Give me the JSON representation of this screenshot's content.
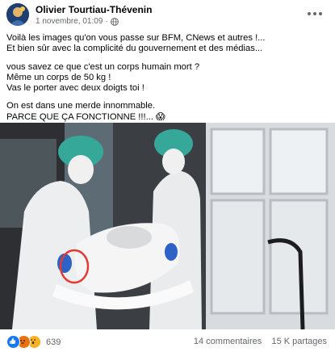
{
  "post": {
    "author": "Olivier Tourtiau-Thévenin",
    "timestamp": "1 novembre, 01:09",
    "separator": "·",
    "privacy_icon": "globe-icon",
    "lines": [
      "Voilà les images qu'on vous passe sur BFM, CNews et autres !...",
      "Et bien sûr avec la complicité du gouvernement et des médias...",
      "vous savez ce que c'est un corps humain mort ?",
      "Même un corps de 50 kg !",
      "Vas le porter avec deux doigts toi !",
      "On est dans une merde innommable.",
      "PARCE QUE ÇA FONCTIONNE !!!... 😱"
    ]
  },
  "footer": {
    "reactions": [
      "like-icon",
      "angry-icon",
      "wow-icon"
    ],
    "reaction_count": "639",
    "comments": "14 commentaires",
    "shares": "15 K partages"
  },
  "colors": {
    "like": "#1877f2",
    "angry": "#e9710f",
    "wow": "#f7b125",
    "secondary_text": "#65676b"
  }
}
